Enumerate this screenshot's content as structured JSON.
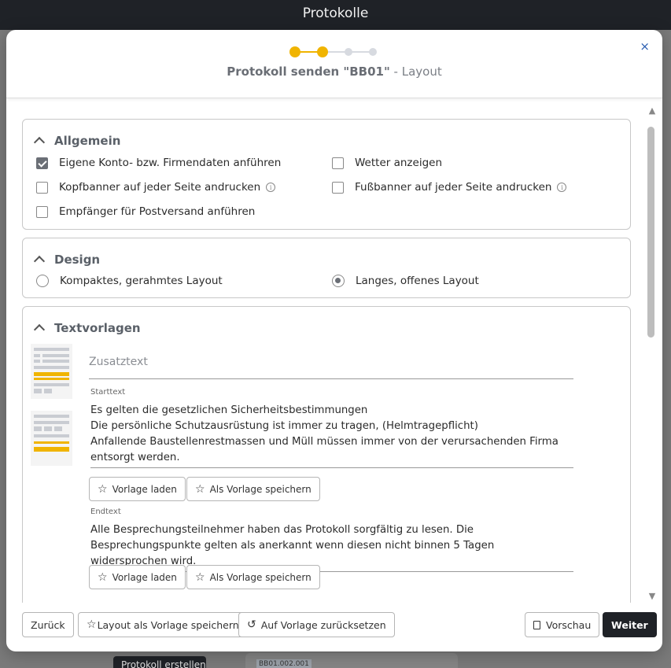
{
  "app": {
    "title": "Protokolle",
    "bg_button": "Protokoll erstellen",
    "bg_chip": "BB01.002.001"
  },
  "modal": {
    "title_bold": "Protokoll senden \"BB01\"",
    "title_suffix": " - Layout",
    "close_icon": "×",
    "steps": {
      "total": 4,
      "completed": 2,
      "active_color": "#f0b400",
      "inactive_color": "#d7dae0"
    }
  },
  "allgemein": {
    "title": "Allgemein",
    "options": [
      {
        "label": "Eigene Konto- bzw. Firmendaten anführen",
        "checked": true
      },
      {
        "label": "Wetter anzeigen",
        "checked": false
      },
      {
        "label": "Kopfbanner auf jeder Seite andrucken",
        "checked": false,
        "info": true
      },
      {
        "label": "Fußbanner auf jeder Seite andrucken",
        "checked": false,
        "info": true
      },
      {
        "label": "Empfänger für Postversand anführen",
        "checked": false
      }
    ]
  },
  "design": {
    "title": "Design",
    "options": [
      {
        "label": "Kompaktes, gerahmtes Layout",
        "selected": false
      },
      {
        "label": "Langes, offenes Layout",
        "selected": true
      }
    ]
  },
  "textvorlagen": {
    "title": "Textvorlagen",
    "zusatz_placeholder": "Zusatztext",
    "start_label": "Starttext",
    "start_text": "Es gelten die gesetzlichen Sicherheitsbestimmungen\nDie persönliche Schutzausrüstung ist immer zu tragen, (Helmtragepflicht)\nAnfallende Baustellenrestmassen und Müll müssen immer von der verursachenden Firma entsorgt werden.",
    "end_label": "Endtext",
    "end_text": "Alle Besprechungsteilnehmer haben das Protokoll sorgfältig zu lesen. Die Besprechungspunkte gelten als anerkannt wenn diesen nicht binnen 5 Tagen widersprochen wird.",
    "load_label": "Vorlage laden",
    "save_label": "Als Vorlage speichern"
  },
  "footer": {
    "back": "Zurück",
    "save_layout": "Layout als Vorlage speichern",
    "reset": "Auf Vorlage zurücksetzen",
    "preview": "Vorschau",
    "next": "Weiter"
  },
  "icons": {
    "star": "☆",
    "info": "i",
    "undo": "↺",
    "scroll_up": "▲",
    "scroll_down": "▼"
  }
}
